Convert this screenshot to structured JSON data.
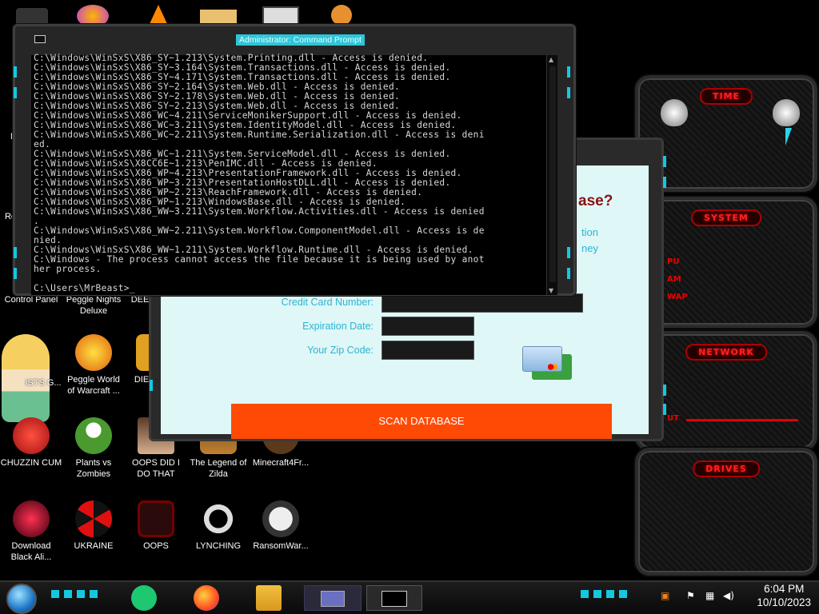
{
  "cmd_window": {
    "title": "Administrator: Command Prompt",
    "lines": [
      "C:\\Windows\\WinSxS\\X86_SY~1.213\\System.Printing.dll - Access is denied.",
      "C:\\Windows\\WinSxS\\X86_SY~3.164\\System.Transactions.dll - Access is denied.",
      "C:\\Windows\\WinSxS\\X86_SY~4.171\\System.Transactions.dll - Access is denied.",
      "C:\\Windows\\WinSxS\\X86_SY~2.164\\System.Web.dll - Access is denied.",
      "C:\\Windows\\WinSxS\\X86_SY~2.178\\System.Web.dll - Access is denied.",
      "C:\\Windows\\WinSxS\\X86_SY~2.213\\System.Web.dll - Access is denied.",
      "C:\\Windows\\WinSxS\\X86_WC~4.211\\ServiceMonikerSupport.dll - Access is denied.",
      "C:\\Windows\\WinSxS\\X86_WC~3.211\\System.IdentityModel.dll - Access is denied.",
      "C:\\Windows\\WinSxS\\X86_WC~2.211\\System.Runtime.Serialization.dll - Access is deni",
      "ed.",
      "C:\\Windows\\WinSxS\\X86_WC~1.211\\System.ServiceModel.dll - Access is denied.",
      "C:\\Windows\\WinSxS\\X8CC6E~1.213\\PenIMC.dll - Access is denied.",
      "C:\\Windows\\WinSxS\\X86_WP~4.213\\PresentationFramework.dll - Access is denied.",
      "C:\\Windows\\WinSxS\\X86_WP~3.213\\PresentationHostDLL.dll - Access is denied.",
      "C:\\Windows\\WinSxS\\X86_WP~2.213\\ReachFramework.dll - Access is denied.",
      "C:\\Windows\\WinSxS\\X86_WP~1.213\\WindowsBase.dll - Access is denied.",
      "C:\\Windows\\WinSxS\\X86_WW~3.211\\System.Workflow.Activities.dll - Access is denied",
      ".",
      "C:\\Windows\\WinSxS\\X86_WW~2.211\\System.Workflow.ComponentModel.dll - Access is de",
      "nied.",
      "C:\\Windows\\WinSxS\\X86_WW~1.211\\System.Workflow.Runtime.dll - Access is denied.",
      "C:\\Windows - The process cannot access the file because it is being used by anot",
      "her process.",
      "",
      "C:\\Users\\MrBeast>_"
    ]
  },
  "scanner_window": {
    "heading_fragment": "ase?",
    "text_fragment_1": "tion",
    "text_fragment_2": "ney",
    "credit_card_label": "Credit Card Number:",
    "expiration_label": "Expiration Date:",
    "zip_label": "Your Zip Code:",
    "scan_button": "SCAN DATABASE"
  },
  "gadget": {
    "time_label": "TIME",
    "system_label": "SYSTEM",
    "system_lines": [
      "PU",
      "AM",
      "WAP"
    ],
    "network_label": "NETWORK",
    "network_line": "UT",
    "drives_label": "DRIVES"
  },
  "desktop_icons": [
    {
      "label": "Re"
    },
    {
      "label": "N"
    },
    {
      "label": "Control Panel"
    },
    {
      "label": "Peggle Nights Deluxe"
    },
    {
      "label": "DEE"
    },
    {
      "label": "ISTS G..."
    },
    {
      "label": "Peggle World of Warcraft ..."
    },
    {
      "label": "DIE"
    },
    {
      "label": "CHUZZIN CUM"
    },
    {
      "label": "Plants vs Zombies"
    },
    {
      "label": "OOPS DID I DO THAT"
    },
    {
      "label": "The Legend of Zilda"
    },
    {
      "label": "Minecraft4Fr..."
    },
    {
      "label": "Download Black Ali..."
    },
    {
      "label": "UKRAINE"
    },
    {
      "label": "OOPS"
    },
    {
      "label": "LYNCHING"
    },
    {
      "label": "RansomWar..."
    }
  ],
  "taskbar": {
    "time": "6:04 PM",
    "date": "10/10/2023"
  }
}
